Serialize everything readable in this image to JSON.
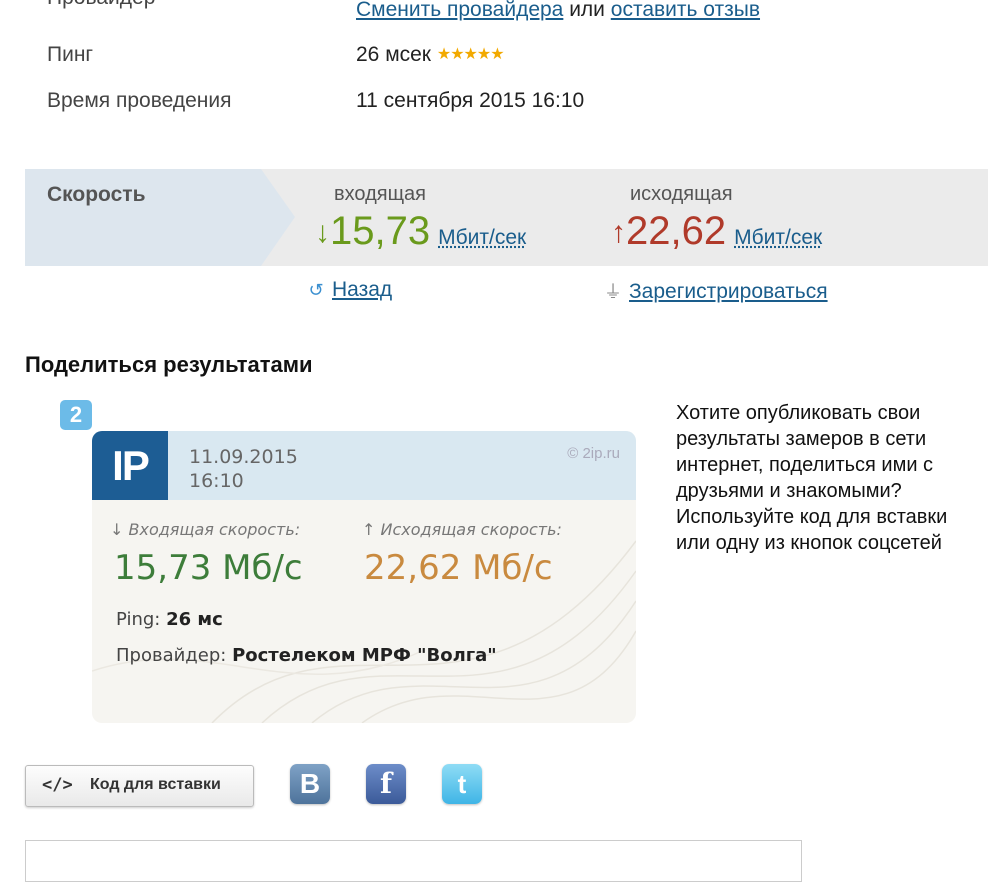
{
  "info": {
    "provider_label": "Провайдер",
    "change_provider_link": "Сменить провайдера",
    "or_text": "или",
    "leave_review_link": "оставить отзыв",
    "ping_label": "Пинг",
    "ping_value": "26 мсек",
    "ping_rating": "★★★★★",
    "time_label": "Время проведения",
    "time_value": "11 сентября 2015 16:10"
  },
  "speed": {
    "title": "Скорость",
    "incoming_label": "входящая",
    "incoming_arrow": "↓",
    "incoming_value": "15,73",
    "incoming_unit": "Мбит/сек",
    "outgoing_label": "исходящая",
    "outgoing_arrow": "↑",
    "outgoing_value": "22,62",
    "outgoing_unit": "Мбит/сек"
  },
  "nav": {
    "back_label": "Назад",
    "register_label": "Зарегистрироваться"
  },
  "share": {
    "heading": "Поделиться результатами",
    "badge": "2",
    "description": "Хотите опубликовать свои результаты замеров в сети интернет, поделиться ими с друзьями и знакомыми? Используйте код для вставки или одну из кнопок соцсетей",
    "embed_icon": "</>",
    "embed_button": "Код для вставки"
  },
  "card": {
    "logo": "IP",
    "date": "11.09.2015",
    "time": "16:10",
    "brand": "© 2ip.ru",
    "incoming_caption": "↓ Входящая скорость:",
    "outgoing_caption": "↑ Исходящая скорость:",
    "incoming_value": "15,73 Мб/с",
    "outgoing_value": "22,62 Мб/с",
    "ping_label": "Ping:",
    "ping_value": "26 мс",
    "provider_label": "Провайдер:",
    "provider_value": "Ростелеком МРФ \"Волга\""
  },
  "social": {
    "vk": "B",
    "facebook": "f",
    "twitter": "t"
  },
  "icons": {
    "back": "back-arrow-icon",
    "register": "plug-icon",
    "code": "code-icon"
  },
  "colors": {
    "incoming": "#6a9a1c",
    "outgoing": "#b03a2a",
    "link": "#1a5d8c",
    "stars": "#f2a900"
  }
}
